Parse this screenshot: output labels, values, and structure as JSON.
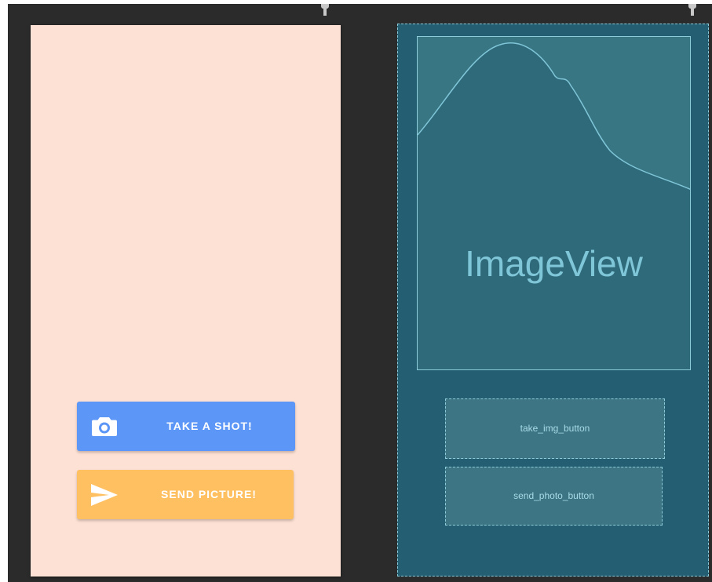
{
  "design": {
    "background_color": "#fde1d4",
    "take_shot_button": {
      "label": "TAKE A SHOT!",
      "icon": "camera-icon",
      "color": "#5c96f6"
    },
    "send_picture_button": {
      "label": "SEND PICTURE!",
      "icon": "send-icon",
      "color": "#ffc062"
    }
  },
  "blueprint": {
    "background_color": "#235e72",
    "image_view": {
      "label": "ImageView",
      "icon": "image-placeholder-icon"
    },
    "take_img_button": {
      "label": "take_img_button"
    },
    "send_photo_button": {
      "label": "send_photo_button"
    }
  }
}
